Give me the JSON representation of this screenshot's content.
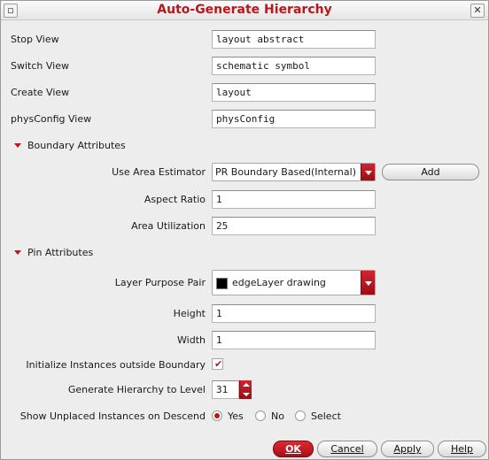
{
  "window": {
    "title": "Auto-Generate Hierarchy"
  },
  "views": {
    "stop_view": {
      "label": "Stop View",
      "value": "layout abstract"
    },
    "switch_view": {
      "label": "Switch View",
      "value": "schematic symbol"
    },
    "create_view": {
      "label": "Create View",
      "value": "layout"
    },
    "physconfig_view": {
      "label": "physConfig View",
      "value": "physConfig"
    }
  },
  "boundary": {
    "section_label": "Boundary Attributes",
    "area_estimator": {
      "label": "Use Area Estimator",
      "selected": "PR Boundary Based(Internal)"
    },
    "add_button": "Add",
    "aspect_ratio": {
      "label": "Aspect Ratio",
      "value": "1"
    },
    "area_utilization": {
      "label": "Area Utilization",
      "value": "25"
    }
  },
  "pins": {
    "section_label": "Pin Attributes",
    "layer_purpose_pair": {
      "label": "Layer Purpose Pair",
      "selected": "edgeLayer drawing",
      "swatch_color": "#000000"
    },
    "height": {
      "label": "Height",
      "value": "1"
    },
    "width": {
      "label": "Width",
      "value": "1"
    }
  },
  "options": {
    "init_instances": {
      "label": "Initialize Instances outside Boundary",
      "checked": true
    },
    "generate_level": {
      "label": "Generate Hierarchy to Level",
      "value": "31"
    },
    "show_unplaced": {
      "label": "Show Unplaced Instances on Descend",
      "choices": [
        "Yes",
        "No",
        "Select"
      ],
      "selected": "Yes"
    }
  },
  "buttons": {
    "ok": "OK",
    "cancel": "Cancel",
    "apply": "Apply",
    "help": "Help"
  },
  "colors": {
    "accent": "#c0141c",
    "background": "#ededed"
  }
}
